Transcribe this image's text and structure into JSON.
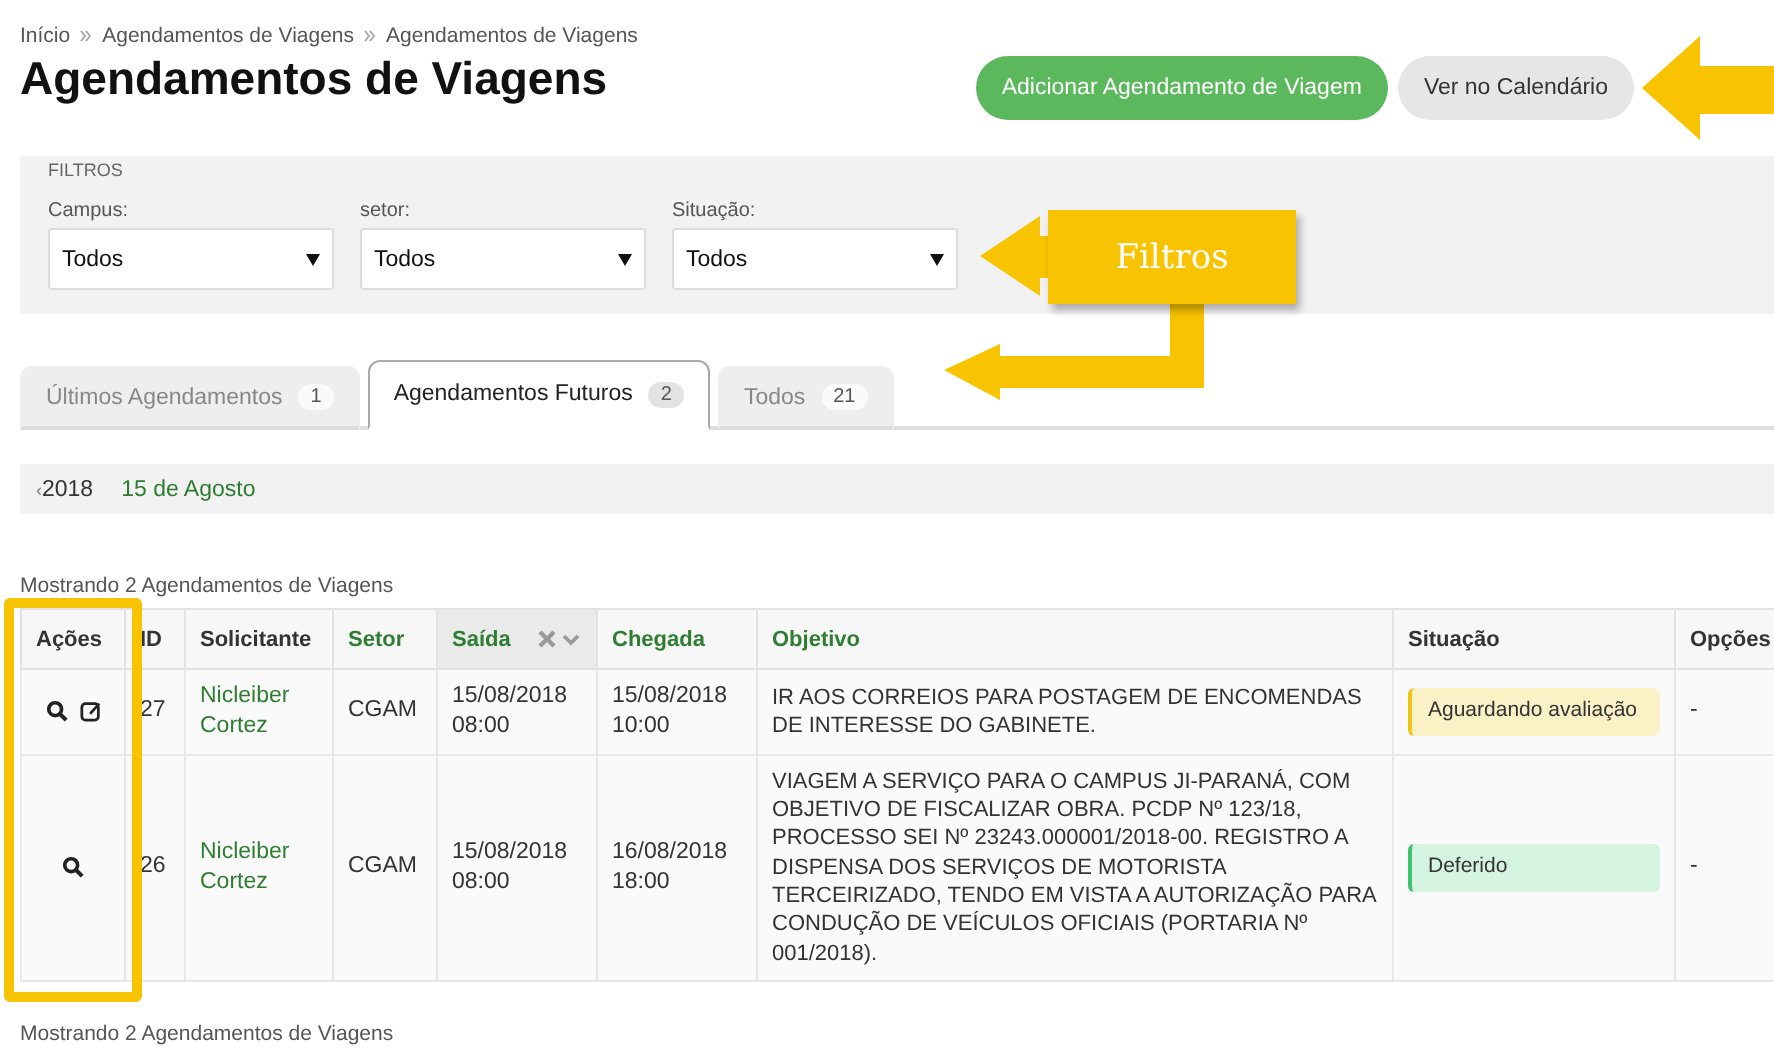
{
  "breadcrumb": [
    "Início",
    "Agendamentos de Viagens",
    "Agendamentos de Viagens"
  ],
  "title": "Agendamentos de Viagens",
  "buttons": [
    {
      "label": "Adicionar Agendamento de Viagem",
      "kind": "primary"
    },
    {
      "label": "Ver no Calendário",
      "kind": "secondary"
    }
  ],
  "filters": {
    "legend": "FILTROS",
    "fields": [
      {
        "label": "Campus:",
        "value": "Todos"
      },
      {
        "label": "setor:",
        "value": "Todos"
      },
      {
        "label": "Situação:",
        "value": "Todos"
      }
    ]
  },
  "tabs": [
    {
      "label": "Últimos Agendamentos",
      "count": "1",
      "selected": false
    },
    {
      "label": "Agendamentos Futuros",
      "count": "2",
      "selected": true
    },
    {
      "label": "Todos",
      "count": "21",
      "selected": false
    }
  ],
  "date_nav": {
    "back": "‹",
    "year": "2018",
    "day": "15 de Agosto"
  },
  "summary_top": "Mostrando 2 Agendamentos de Viagens",
  "table": {
    "columns": [
      {
        "label": "Ações",
        "sortable": false,
        "sorted": false
      },
      {
        "label": "ID",
        "sortable": false,
        "sorted": false
      },
      {
        "label": "Solicitante",
        "sortable": false,
        "sorted": false
      },
      {
        "label": "Setor",
        "sortable": true,
        "sorted": false
      },
      {
        "label": "Saída",
        "sortable": true,
        "sorted": true
      },
      {
        "label": "Chegada",
        "sortable": true,
        "sorted": false
      },
      {
        "label": "Objetivo",
        "sortable": true,
        "sorted": false
      },
      {
        "label": "Situação",
        "sortable": false,
        "sorted": false
      },
      {
        "label": "Opções",
        "sortable": false,
        "sorted": false
      }
    ],
    "rows": [
      {
        "editable": true,
        "id": "27",
        "requester": "Nicleiber Cortez",
        "sector": "CGAM",
        "departure": [
          "15/08/2018",
          "08:00"
        ],
        "arrival": [
          "15/08/2018",
          "10:00"
        ],
        "objective": "IR AOS CORREIOS PARA POSTAGEM DE ENCOMENDAS DE INTERESSE DO GABINETE.",
        "status": {
          "label": "Aguardando avaliação",
          "kind": "pending"
        },
        "options": "-"
      },
      {
        "editable": false,
        "id": "26",
        "requester": "Nicleiber Cortez",
        "sector": "CGAM",
        "departure": [
          "15/08/2018",
          "08:00"
        ],
        "arrival": [
          "16/08/2018",
          "18:00"
        ],
        "objective": "VIAGEM A SERVIÇO PARA O CAMPUS JI-PARANÁ, COM OBJETIVO DE FISCALIZAR OBRA. PCDP Nº 123/18, PROCESSO SEI Nº 23243.000001/2018-00. REGISTRO A DISPENSA DOS SERVIÇOS DE MOTORISTA TERCEIRIZADO, TENDO EM VISTA A AUTORIZAÇÃO PARA CONDUÇÃO DE VEÍCULOS OFICIAIS (PORTARIA Nº 001/2018).",
        "status": {
          "label": "Deferido",
          "kind": "approved"
        },
        "options": "-"
      }
    ]
  },
  "summary_bottom": "Mostrando 2 Agendamentos de Viagens",
  "annotation": {
    "label": "Filtros"
  }
}
